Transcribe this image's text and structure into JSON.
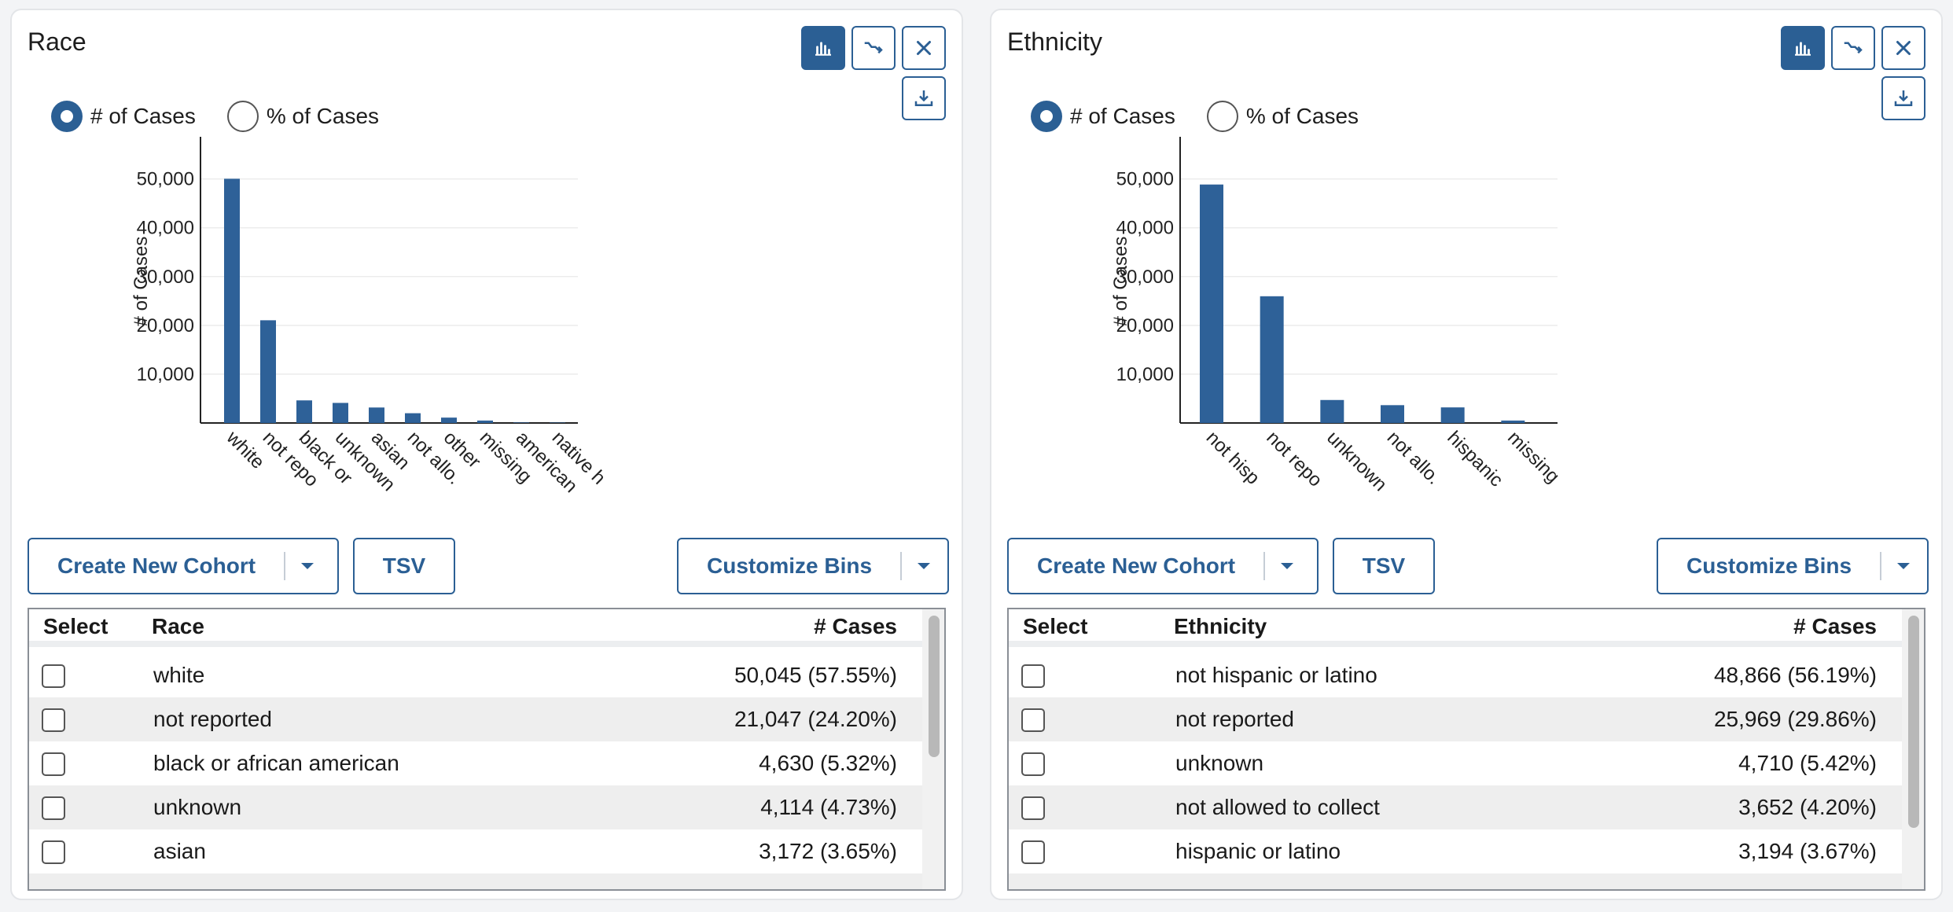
{
  "panels": [
    {
      "title": "Race",
      "radio": {
        "count_label": "# of Cases",
        "percent_label": "% of Cases",
        "selected": "count"
      },
      "buttons": {
        "create": "Create New Cohort",
        "tsv": "TSV",
        "customize": "Customize Bins"
      },
      "table": {
        "col_select": "Select",
        "col_name": "Race",
        "col_cases": "# Cases",
        "rows": [
          {
            "name": "white",
            "cases": "50,045 (57.55%)"
          },
          {
            "name": "not reported",
            "cases": "21,047 (24.20%)"
          },
          {
            "name": "black or african american",
            "cases": "4,630 (5.32%)"
          },
          {
            "name": "unknown",
            "cases": "4,114 (4.73%)"
          },
          {
            "name": "asian",
            "cases": "3,172 (3.65%)"
          }
        ]
      },
      "chart_data": {
        "type": "bar",
        "ylabel": "# of Cases",
        "ylim": [
          0,
          58000
        ],
        "yticks": [
          "10,000",
          "20,000",
          "30,000",
          "40,000",
          "50,000"
        ],
        "categories": [
          "white",
          "not repo",
          "black or",
          "unknown",
          "asian",
          "not allo.",
          "other",
          "missing",
          "american",
          "native h"
        ],
        "values": [
          50045,
          21047,
          4630,
          4114,
          3172,
          2000,
          1100,
          500,
          100,
          80
        ],
        "color": "#2e6198"
      }
    },
    {
      "title": "Ethnicity",
      "radio": {
        "count_label": "# of Cases",
        "percent_label": "% of Cases",
        "selected": "count"
      },
      "buttons": {
        "create": "Create New Cohort",
        "tsv": "TSV",
        "customize": "Customize Bins"
      },
      "table": {
        "col_select": "Select",
        "col_name": "Ethnicity",
        "col_cases": "# Cases",
        "rows": [
          {
            "name": "not hispanic or latino",
            "cases": "48,866 (56.19%)"
          },
          {
            "name": "not reported",
            "cases": "25,969 (29.86%)"
          },
          {
            "name": "unknown",
            "cases": "4,710 (5.42%)"
          },
          {
            "name": "not allowed to collect",
            "cases": "3,652 (4.20%)"
          },
          {
            "name": "hispanic or latino",
            "cases": "3,194 (3.67%)"
          }
        ]
      },
      "chart_data": {
        "type": "bar",
        "ylabel": "# of Cases",
        "ylim": [
          0,
          58000
        ],
        "yticks": [
          "10,000",
          "20,000",
          "30,000",
          "40,000",
          "50,000"
        ],
        "categories": [
          "not hisp",
          "not repo",
          "unknown",
          "not allo.",
          "hispanic",
          "missing"
        ],
        "values": [
          48866,
          25969,
          4710,
          3652,
          3194,
          500
        ],
        "color": "#2e6198"
      }
    }
  ]
}
